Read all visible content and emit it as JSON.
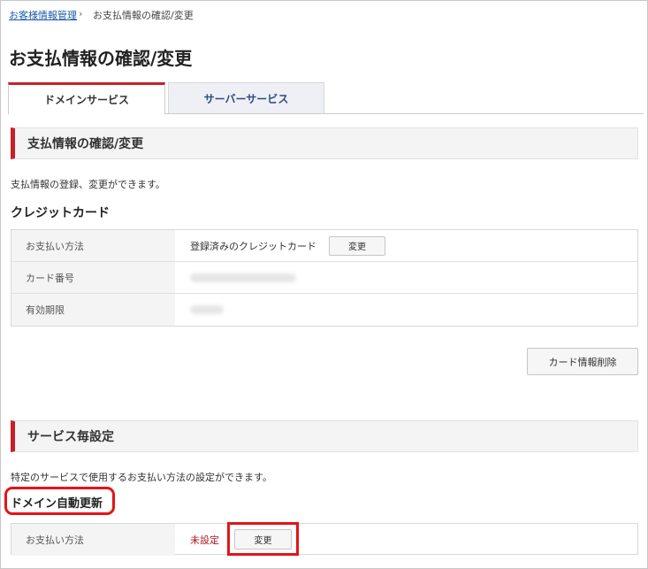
{
  "breadcrumb": {
    "parent": "お客様情報管理",
    "separator": "›",
    "current": "お支払情報の確認/変更"
  },
  "page_title": "お支払情報の確認/変更",
  "tabs": [
    {
      "label": "ドメインサービス",
      "active": true
    },
    {
      "label": "サーバーサービス",
      "active": false
    }
  ],
  "payment_section": {
    "heading": "支払情報の確認/変更",
    "description": "支払情報の登録、変更ができます。",
    "subheading": "クレジットカード",
    "rows": [
      {
        "label": "お支払い方法",
        "value": "登録済みのクレジットカード",
        "button": "変更"
      },
      {
        "label": "カード番号"
      },
      {
        "label": "有効期限"
      }
    ],
    "delete_button": "カード情報削除"
  },
  "service_section": {
    "heading": "サービス毎設定",
    "description": "特定のサービスで使用するお支払い方法の設定ができます。",
    "subheading": "ドメイン自動更新",
    "row": {
      "label": "お支払い方法",
      "value": "未設定",
      "button": "変更"
    }
  },
  "colors": {
    "accent_red": "#c8202a",
    "highlight_red": "#e3141a",
    "link_blue": "#1a5aa8",
    "tab_text_blue": "#2f4a83",
    "unset_red": "#b0141c"
  }
}
